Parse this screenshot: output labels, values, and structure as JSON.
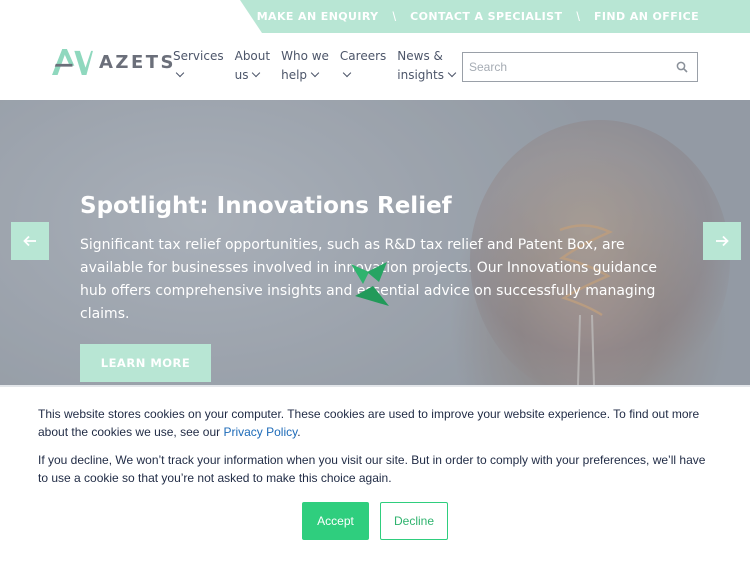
{
  "utility_bar": {
    "links": [
      "MAKE AN ENQUIRY",
      "CONTACT A SPECIALIST",
      "FIND AN OFFICE"
    ],
    "separator": "\\",
    "background": "#b8e6d4"
  },
  "brand": {
    "name": "AZETS",
    "accent": "#b8e6d4",
    "logo_colors": [
      "#8fd8be",
      "#6b6f7a"
    ]
  },
  "nav": {
    "items": [
      {
        "line1": "Services",
        "line2": ""
      },
      {
        "line1": "About",
        "line2": "us"
      },
      {
        "line1": "Who we",
        "line2": "help"
      },
      {
        "line1": "Careers",
        "line2": ""
      },
      {
        "line1": "News &",
        "line2": "insights"
      }
    ],
    "chevron_icon": "chevron-down-icon"
  },
  "search": {
    "placeholder": "Search",
    "value": "",
    "icon": "search-icon"
  },
  "hero": {
    "title": "Spotlight: Innovations Relief",
    "body": "Significant tax relief opportunities, such as R&D tax relief and Patent Box, are available for businesses involved in innovation projects. Our Innovations guidance hub offers comprehensive insights and essential advice on successfully managing claims.",
    "button_label": "LEARN MORE",
    "prev_icon": "arrow-left-icon",
    "next_icon": "arrow-right-icon",
    "loading_icon": "loading-spinner-icon"
  },
  "cookie_banner": {
    "text1_before": "This website stores cookies on your computer. These cookies are used to improve your website experience. To find out more about the cookies we use, see our ",
    "privacy_link": "Privacy Policy",
    "text1_after": ".",
    "text2": "If you decline, We won’t track your information when you visit our site. But in order to comply with your preferences, we’ll have to use a cookie so that you’re not asked to make this choice again.",
    "accept_label": "Accept",
    "decline_label": "Decline",
    "accept_color": "#2fce7e"
  }
}
